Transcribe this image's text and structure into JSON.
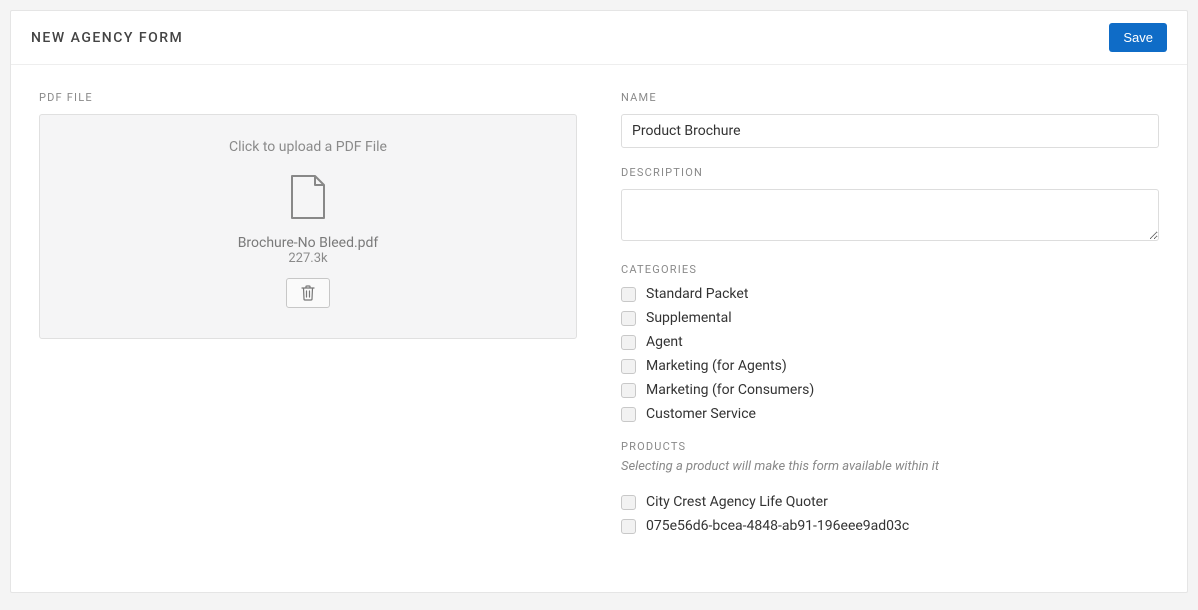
{
  "header": {
    "title": "NEW AGENCY FORM",
    "save_label": "Save"
  },
  "pdf": {
    "section_label": "PDF FILE",
    "upload_hint": "Click to upload a PDF File",
    "file_name": "Brochure-No Bleed.pdf",
    "file_size": "227.3k"
  },
  "name": {
    "section_label": "NAME",
    "value": "Product Brochure"
  },
  "description": {
    "section_label": "DESCRIPTION",
    "value": ""
  },
  "categories": {
    "section_label": "CATEGORIES",
    "items": [
      {
        "label": "Standard Packet"
      },
      {
        "label": "Supplemental"
      },
      {
        "label": "Agent"
      },
      {
        "label": "Marketing (for Agents)"
      },
      {
        "label": "Marketing (for Consumers)"
      },
      {
        "label": "Customer Service"
      }
    ]
  },
  "products": {
    "section_label": "PRODUCTS",
    "hint": "Selecting a product will make this form available within it",
    "items": [
      {
        "label": "City Crest Agency Life Quoter"
      },
      {
        "label": "075e56d6-bcea-4848-ab91-196eee9ad03c"
      }
    ]
  }
}
